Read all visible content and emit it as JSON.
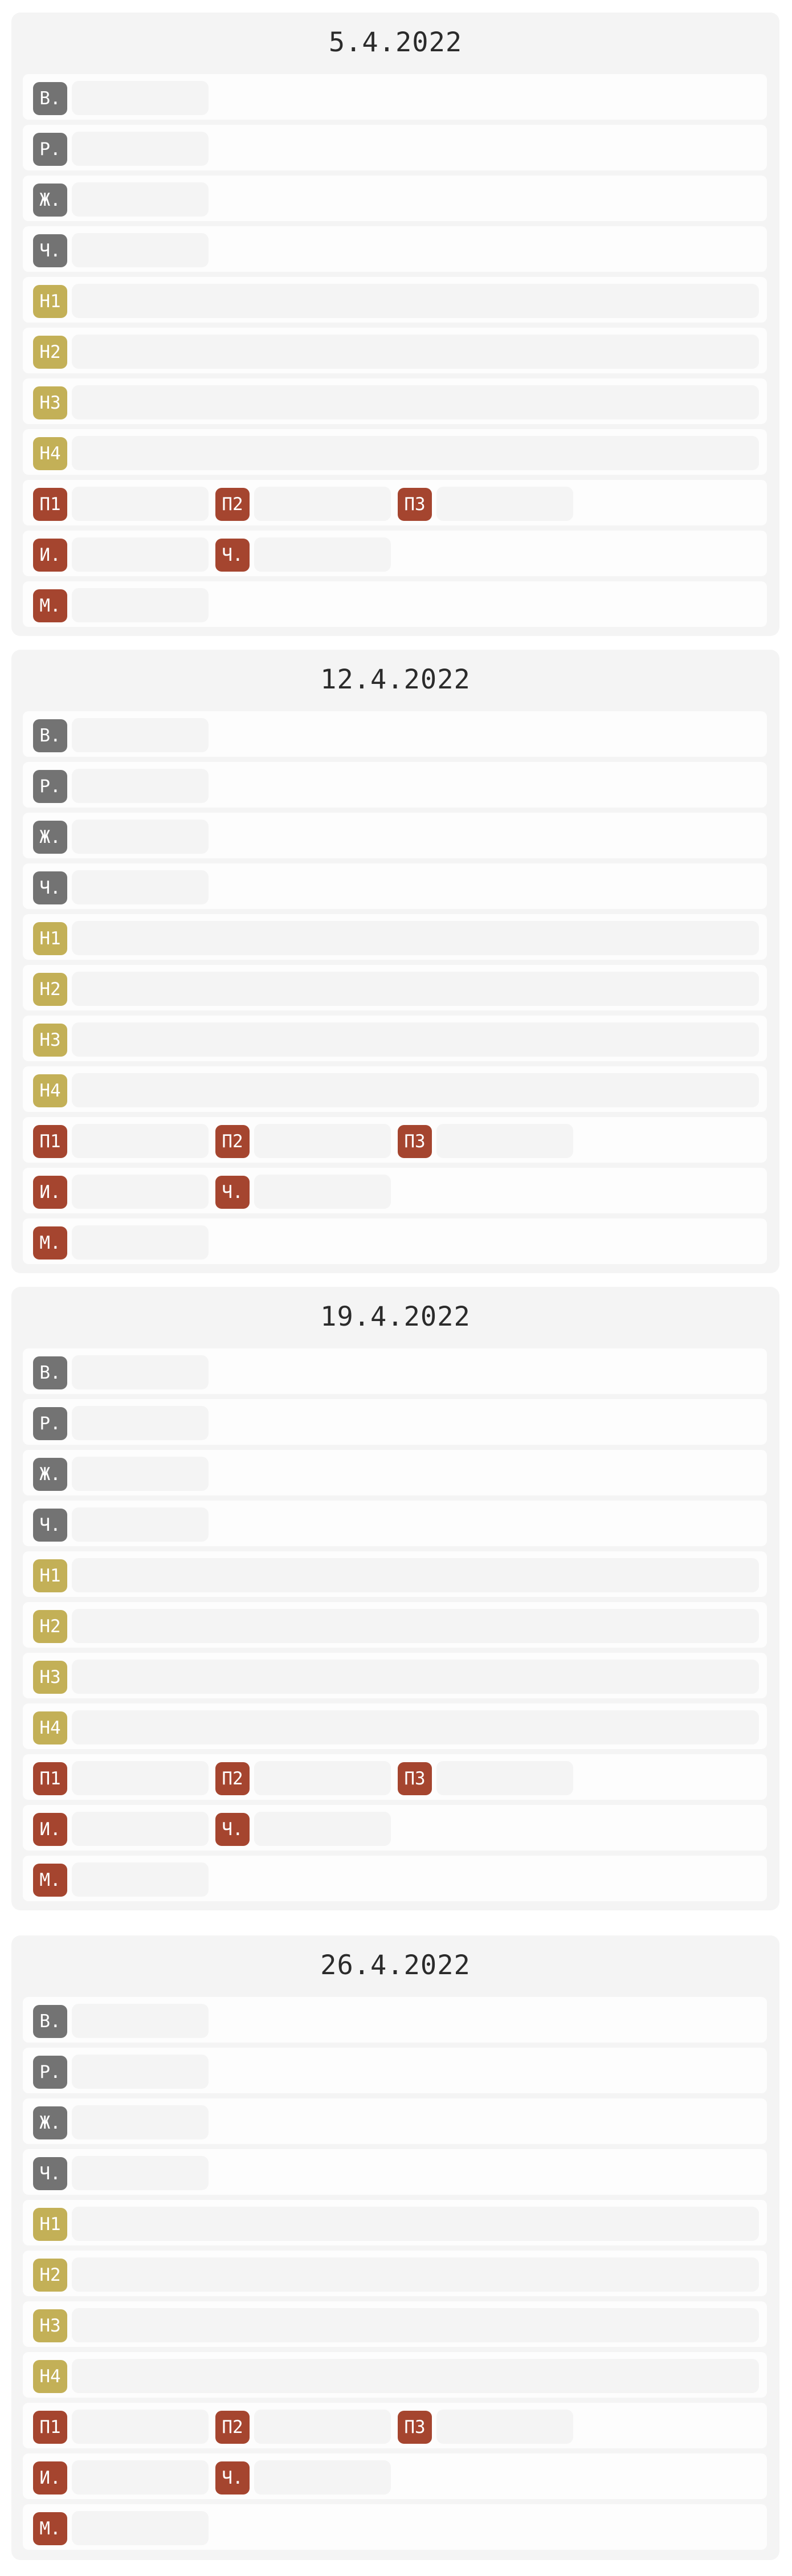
{
  "weeks": [
    {
      "date": "5.4.2022",
      "rows": [
        [
          {
            "badge": "В.",
            "color": "gray",
            "field": "short"
          }
        ],
        [
          {
            "badge": "Р.",
            "color": "gray",
            "field": "short"
          }
        ],
        [
          {
            "badge": "Ж.",
            "color": "gray",
            "field": "short"
          }
        ],
        [
          {
            "badge": "Ч.",
            "color": "gray",
            "field": "short"
          }
        ],
        [
          {
            "badge": "Н1",
            "color": "yellow",
            "field": "long"
          }
        ],
        [
          {
            "badge": "Н2",
            "color": "yellow",
            "field": "long"
          }
        ],
        [
          {
            "badge": "Н3",
            "color": "yellow",
            "field": "long"
          }
        ],
        [
          {
            "badge": "Н4",
            "color": "yellow",
            "field": "long"
          }
        ],
        [
          {
            "badge": "П1",
            "color": "red",
            "field": "short"
          },
          {
            "badge": "П2",
            "color": "red",
            "field": "short"
          },
          {
            "badge": "П3",
            "color": "red",
            "field": "short"
          }
        ],
        [
          {
            "badge": "И.",
            "color": "red",
            "field": "short"
          },
          {
            "badge": "Ч.",
            "color": "red",
            "field": "short"
          }
        ],
        [
          {
            "badge": "М.",
            "color": "red",
            "field": "short"
          }
        ]
      ]
    },
    {
      "date": "12.4.2022",
      "rows": [
        [
          {
            "badge": "В.",
            "color": "gray",
            "field": "short"
          }
        ],
        [
          {
            "badge": "Р.",
            "color": "gray",
            "field": "short"
          }
        ],
        [
          {
            "badge": "Ж.",
            "color": "gray",
            "field": "short"
          }
        ],
        [
          {
            "badge": "Ч.",
            "color": "gray",
            "field": "short"
          }
        ],
        [
          {
            "badge": "Н1",
            "color": "yellow",
            "field": "long"
          }
        ],
        [
          {
            "badge": "Н2",
            "color": "yellow",
            "field": "long"
          }
        ],
        [
          {
            "badge": "Н3",
            "color": "yellow",
            "field": "long"
          }
        ],
        [
          {
            "badge": "Н4",
            "color": "yellow",
            "field": "long"
          }
        ],
        [
          {
            "badge": "П1",
            "color": "red",
            "field": "short"
          },
          {
            "badge": "П2",
            "color": "red",
            "field": "short"
          },
          {
            "badge": "П3",
            "color": "red",
            "field": "short"
          }
        ],
        [
          {
            "badge": "И.",
            "color": "red",
            "field": "short"
          },
          {
            "badge": "Ч.",
            "color": "red",
            "field": "short"
          }
        ],
        [
          {
            "badge": "М.",
            "color": "red",
            "field": "short"
          }
        ]
      ]
    },
    {
      "date": "19.4.2022",
      "rows": [
        [
          {
            "badge": "В.",
            "color": "gray",
            "field": "short"
          }
        ],
        [
          {
            "badge": "Р.",
            "color": "gray",
            "field": "short"
          }
        ],
        [
          {
            "badge": "Ж.",
            "color": "gray",
            "field": "short"
          }
        ],
        [
          {
            "badge": "Ч.",
            "color": "gray",
            "field": "short"
          }
        ],
        [
          {
            "badge": "Н1",
            "color": "yellow",
            "field": "long"
          }
        ],
        [
          {
            "badge": "Н2",
            "color": "yellow",
            "field": "long"
          }
        ],
        [
          {
            "badge": "Н3",
            "color": "yellow",
            "field": "long"
          }
        ],
        [
          {
            "badge": "Н4",
            "color": "yellow",
            "field": "long"
          }
        ],
        [
          {
            "badge": "П1",
            "color": "red",
            "field": "short"
          },
          {
            "badge": "П2",
            "color": "red",
            "field": "short"
          },
          {
            "badge": "П3",
            "color": "red",
            "field": "short"
          }
        ],
        [
          {
            "badge": "И.",
            "color": "red",
            "field": "short"
          },
          {
            "badge": "Ч.",
            "color": "red",
            "field": "short"
          }
        ],
        [
          {
            "badge": "М.",
            "color": "red",
            "field": "short"
          }
        ]
      ]
    },
    {
      "date": "26.4.2022",
      "rows": [
        [
          {
            "badge": "В.",
            "color": "gray",
            "field": "short"
          }
        ],
        [
          {
            "badge": "Р.",
            "color": "gray",
            "field": "short"
          }
        ],
        [
          {
            "badge": "Ж.",
            "color": "gray",
            "field": "short"
          }
        ],
        [
          {
            "badge": "Ч.",
            "color": "gray",
            "field": "short"
          }
        ],
        [
          {
            "badge": "Н1",
            "color": "yellow",
            "field": "long"
          }
        ],
        [
          {
            "badge": "Н2",
            "color": "yellow",
            "field": "long"
          }
        ],
        [
          {
            "badge": "Н3",
            "color": "yellow",
            "field": "long"
          }
        ],
        [
          {
            "badge": "Н4",
            "color": "yellow",
            "field": "long"
          }
        ],
        [
          {
            "badge": "П1",
            "color": "red",
            "field": "short"
          },
          {
            "badge": "П2",
            "color": "red",
            "field": "short"
          },
          {
            "badge": "П3",
            "color": "red",
            "field": "short"
          }
        ],
        [
          {
            "badge": "И.",
            "color": "red",
            "field": "short"
          },
          {
            "badge": "Ч.",
            "color": "red",
            "field": "short"
          }
        ],
        [
          {
            "badge": "М.",
            "color": "red",
            "field": "short"
          }
        ]
      ]
    }
  ],
  "colors": {
    "gray": "#737373",
    "yellow": "#c3b057",
    "red": "#a5452f",
    "panel": "#f4f4f4",
    "row": "#fdfdfd"
  }
}
